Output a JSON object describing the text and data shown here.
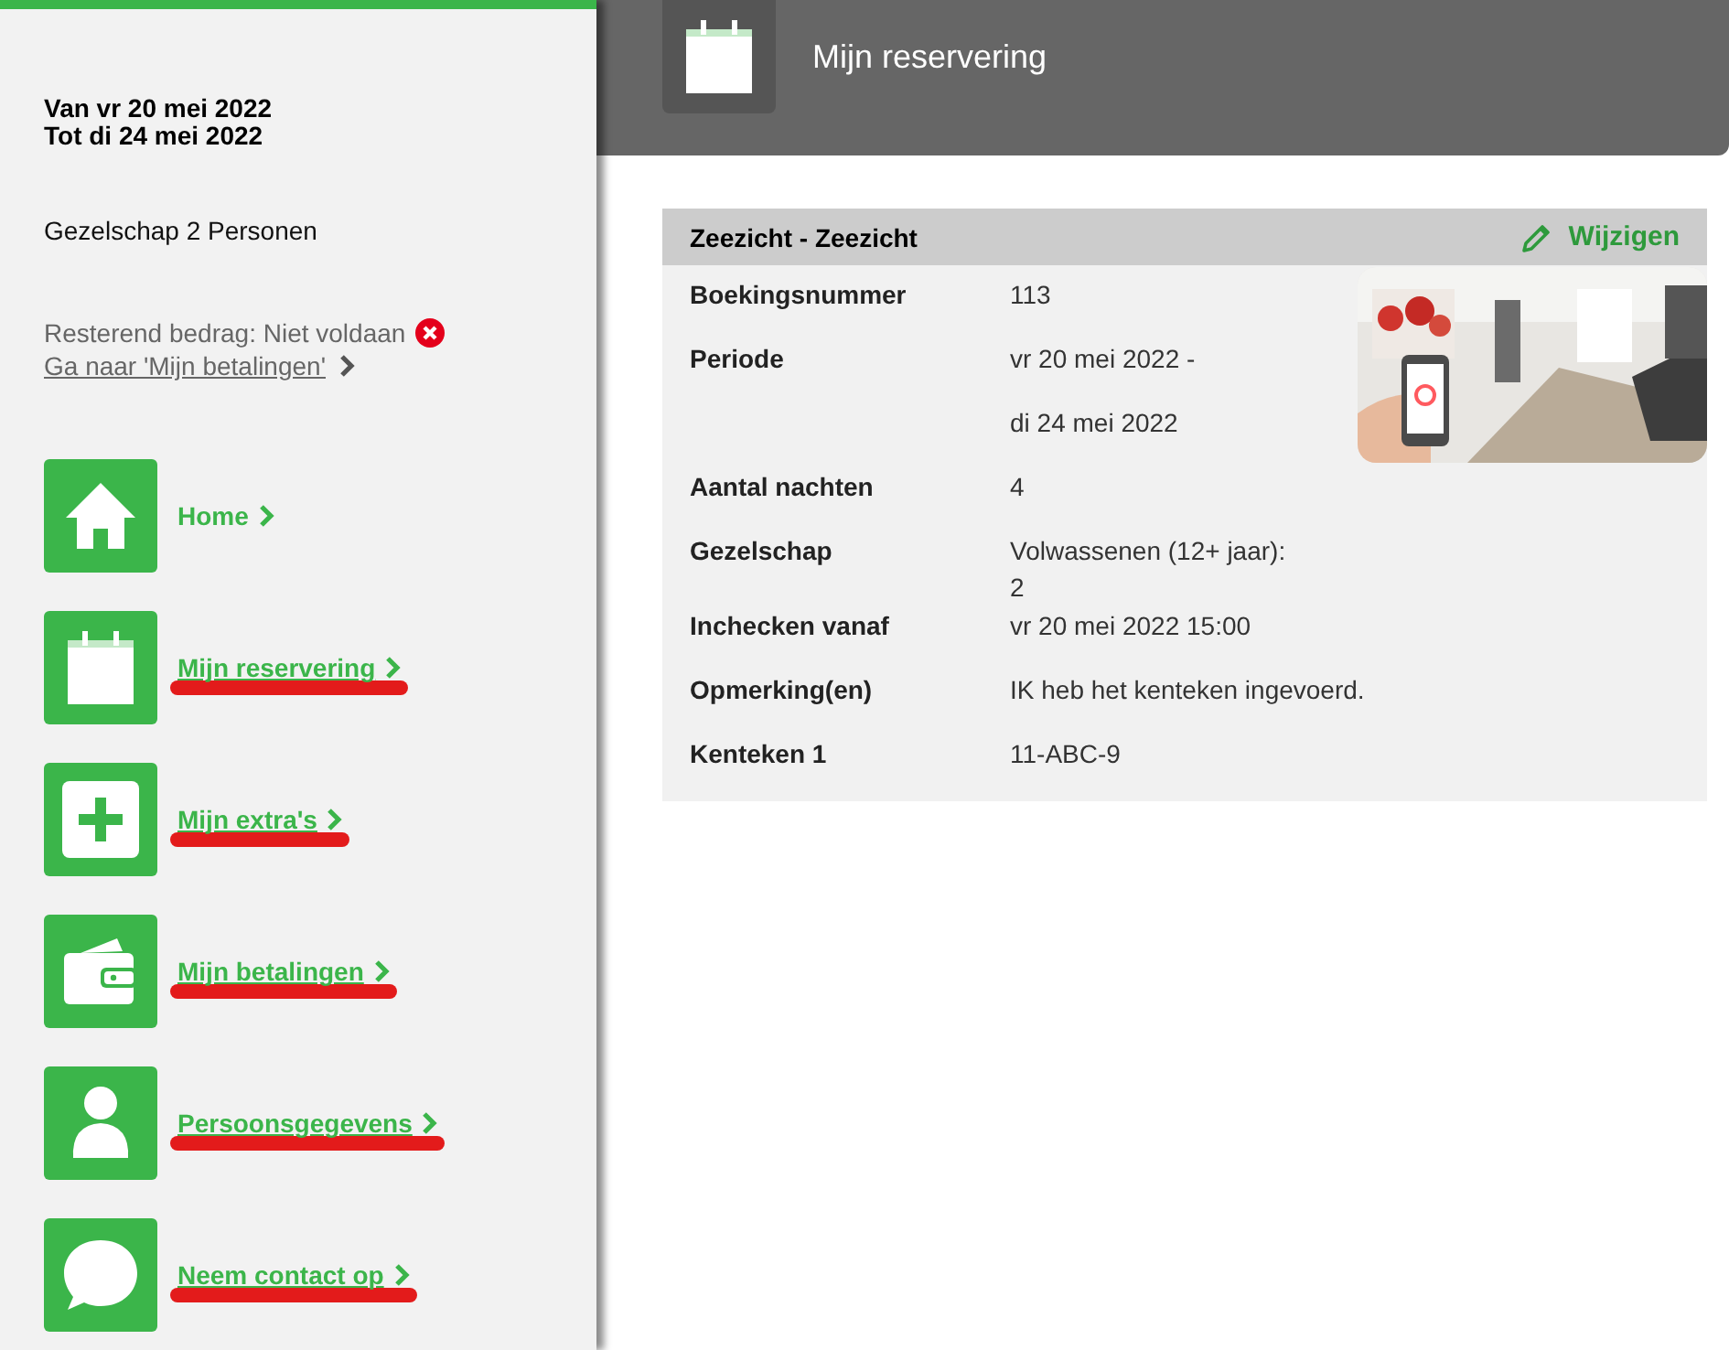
{
  "sidebar": {
    "period": [
      "Van vr 20 mei 2022",
      "Tot di 24 mei 2022"
    ],
    "party": "Gezelschap 2 Personen",
    "balance": {
      "text": "Resterend bedrag: Niet voldaan",
      "paid": false
    },
    "payment_link": "Ga naar 'Mijn betalingen'",
    "nav": [
      {
        "label": "Home",
        "kind": "home",
        "annotated": false
      },
      {
        "label": "Mijn reservering",
        "kind": "calendar",
        "annotated": true
      },
      {
        "label": "Mijn extra's",
        "kind": "plus",
        "annotated": true
      },
      {
        "label": "Mijn betalingen",
        "kind": "wallet",
        "annotated": true
      },
      {
        "label": "Persoonsgegevens",
        "kind": "person",
        "annotated": true
      },
      {
        "label": "Neem contact op",
        "kind": "chat",
        "annotated": true
      }
    ]
  },
  "header": {
    "title": "Mijn reservering"
  },
  "card": {
    "title": "Zeezicht - Zeezicht",
    "edit": "Wijzigen",
    "rows": [
      {
        "label": "Boekingsnummer",
        "lines": [
          "113"
        ]
      },
      {
        "label": "Periode",
        "lines": [
          "vr 20 mei 2022 -"
        ]
      },
      {
        "lines": [
          "di 24 mei 2022"
        ]
      },
      {
        "label": "Aantal nachten",
        "lines": [
          "4"
        ]
      },
      {
        "label": "Gezelschap",
        "lines": [
          "Volwassenen (12+ jaar):",
          "2"
        ]
      },
      {
        "label": "Inchecken vanaf",
        "lines": [
          "vr 20 mei 2022 15:00"
        ]
      },
      {
        "label": "Opmerking(en)",
        "lines": [
          "IK heb het kenteken ingevoerd."
        ]
      },
      {
        "label": "Kenteken 1",
        "lines": [
          "11-ABC-9"
        ]
      }
    ]
  }
}
